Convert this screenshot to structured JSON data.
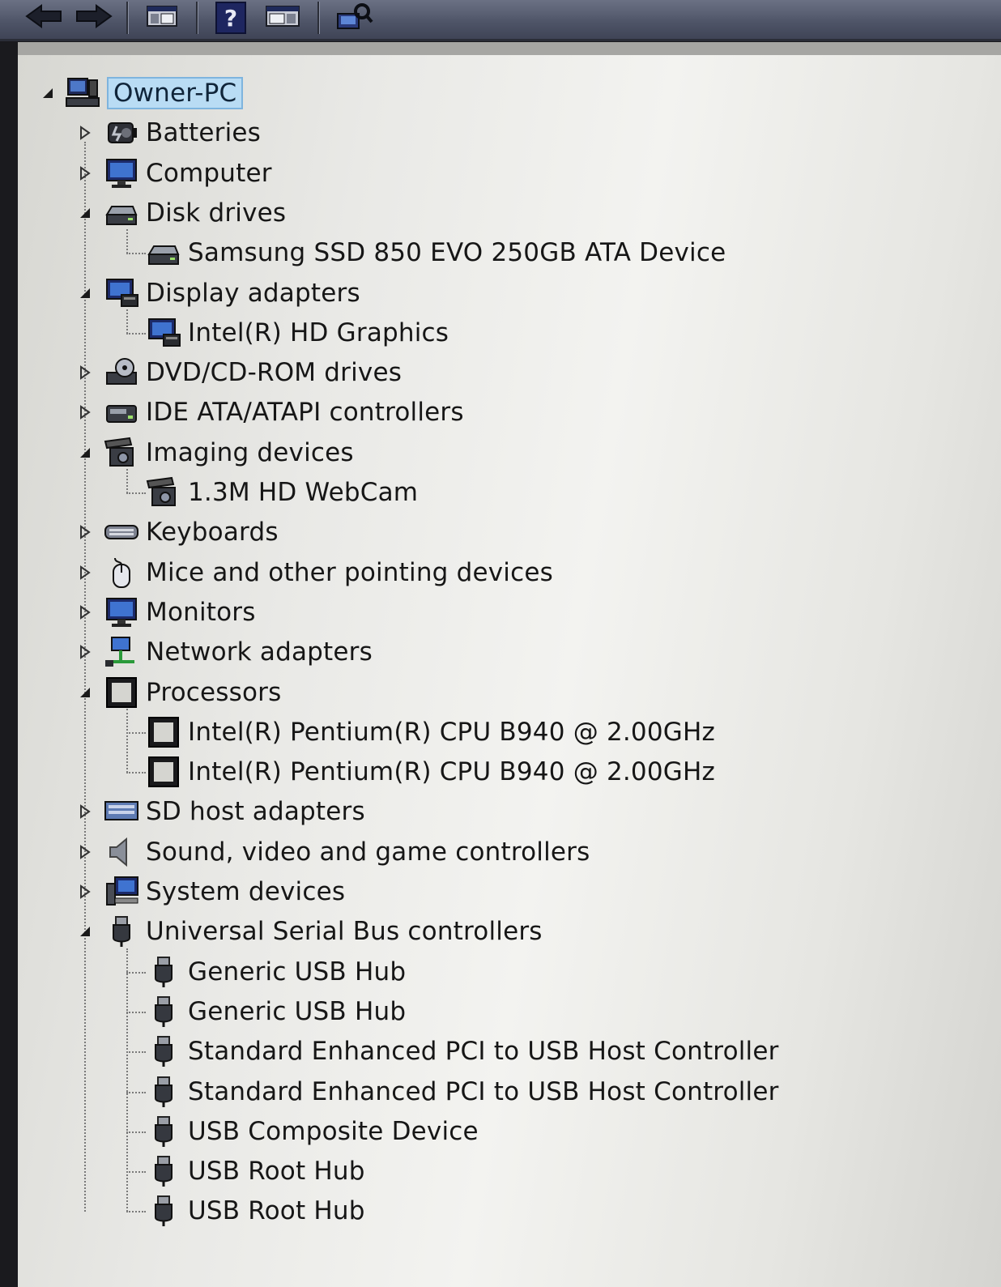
{
  "toolbar": {
    "buttons": [
      {
        "name": "back-button",
        "icon": "arrow-left-icon"
      },
      {
        "name": "forward-button",
        "icon": "arrow-right-icon"
      },
      {
        "name": "show-hide-console-tree-button",
        "icon": "console-tree-icon"
      },
      {
        "name": "help-button",
        "icon": "help-icon",
        "glyph": "?"
      },
      {
        "name": "show-hide-action-pane-button",
        "icon": "action-pane-icon"
      },
      {
        "name": "update-driver-button",
        "icon": "scan-hardware-icon"
      }
    ]
  },
  "tree": {
    "root": {
      "label": "Owner-PC",
      "icon": "computer-icon",
      "expanded": true
    },
    "categories": [
      {
        "label": "Batteries",
        "icon": "battery-icon",
        "expanded": false,
        "children": []
      },
      {
        "label": "Computer",
        "icon": "monitor-icon",
        "expanded": false,
        "children": []
      },
      {
        "label": "Disk drives",
        "icon": "disk-drive-icon",
        "expanded": true,
        "children": [
          {
            "label": "Samsung SSD 850 EVO 250GB ATA Device",
            "icon": "disk-drive-icon"
          }
        ]
      },
      {
        "label": "Display adapters",
        "icon": "display-adapter-icon",
        "expanded": true,
        "children": [
          {
            "label": "Intel(R) HD Graphics",
            "icon": "display-adapter-icon"
          }
        ]
      },
      {
        "label": "DVD/CD-ROM drives",
        "icon": "dvd-drive-icon",
        "expanded": false,
        "children": []
      },
      {
        "label": "IDE ATA/ATAPI controllers",
        "icon": "ide-controller-icon",
        "expanded": false,
        "children": []
      },
      {
        "label": "Imaging devices",
        "icon": "camera-icon",
        "expanded": true,
        "children": [
          {
            "label": "1.3M HD WebCam",
            "icon": "camera-icon"
          }
        ]
      },
      {
        "label": "Keyboards",
        "icon": "keyboard-icon",
        "expanded": false,
        "children": []
      },
      {
        "label": "Mice and other pointing devices",
        "icon": "mouse-icon",
        "expanded": false,
        "children": []
      },
      {
        "label": "Monitors",
        "icon": "monitor-icon",
        "expanded": false,
        "children": []
      },
      {
        "label": "Network adapters",
        "icon": "network-adapter-icon",
        "expanded": false,
        "children": []
      },
      {
        "label": "Processors",
        "icon": "processor-icon",
        "expanded": true,
        "children": [
          {
            "label": "Intel(R) Pentium(R) CPU B940 @ 2.00GHz",
            "icon": "processor-icon"
          },
          {
            "label": "Intel(R) Pentium(R) CPU B940 @ 2.00GHz",
            "icon": "processor-icon"
          }
        ]
      },
      {
        "label": "SD host adapters",
        "icon": "sd-host-adapter-icon",
        "expanded": false,
        "children": []
      },
      {
        "label": "Sound, video and game controllers",
        "icon": "speaker-icon",
        "expanded": false,
        "children": []
      },
      {
        "label": "System devices",
        "icon": "system-devices-icon",
        "expanded": false,
        "children": []
      },
      {
        "label": "Universal Serial Bus controllers",
        "icon": "usb-icon",
        "expanded": true,
        "children": [
          {
            "label": "Generic USB Hub",
            "icon": "usb-icon"
          },
          {
            "label": "Generic USB Hub",
            "icon": "usb-icon"
          },
          {
            "label": "Standard Enhanced PCI to USB Host Controller",
            "icon": "usb-icon"
          },
          {
            "label": "Standard Enhanced PCI to USB Host Controller",
            "icon": "usb-icon"
          },
          {
            "label": "USB Composite Device",
            "icon": "usb-icon"
          },
          {
            "label": "USB Root Hub",
            "icon": "usb-icon"
          },
          {
            "label": "USB Root Hub",
            "icon": "usb-icon"
          }
        ]
      }
    ]
  }
}
